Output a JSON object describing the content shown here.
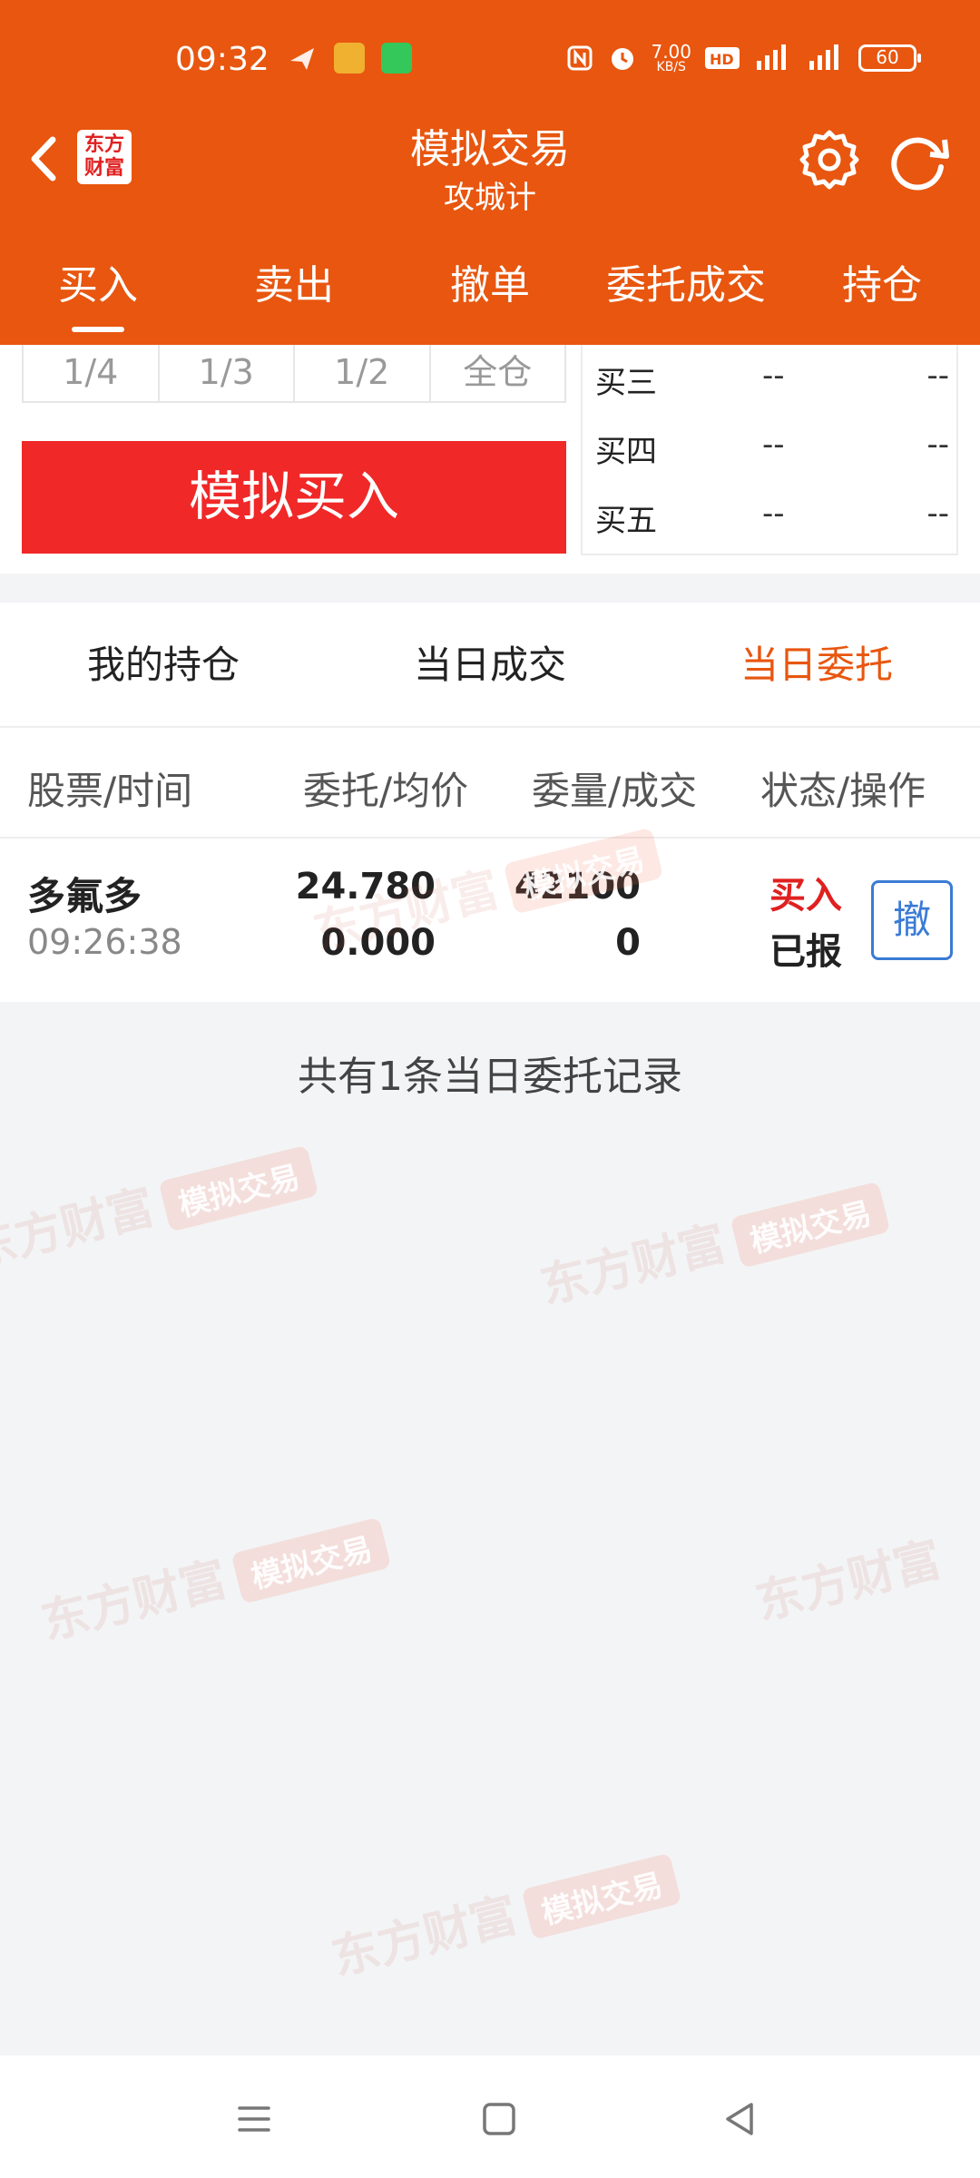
{
  "status_bar": {
    "time": "09:32",
    "net_speed_top": "7.00",
    "net_speed_bottom": "KB/S",
    "battery": "60"
  },
  "header": {
    "logo_text": "东方财富",
    "title": "模拟交易",
    "subtitle": "攻城计",
    "accent_color": "#e8560f"
  },
  "tabs": [
    "买入",
    "卖出",
    "撤单",
    "委托成交",
    "持仓"
  ],
  "order_panel": {
    "fractions": [
      "1/4",
      "1/3",
      "1/2",
      "全仓"
    ],
    "buy_button": "模拟买入",
    "depth": [
      {
        "label": "买三",
        "price": "--",
        "volume": "--"
      },
      {
        "label": "买四",
        "price": "--",
        "volume": "--"
      },
      {
        "label": "买五",
        "price": "--",
        "volume": "--"
      }
    ]
  },
  "subtabs": [
    "我的持仓",
    "当日成交",
    "当日委托"
  ],
  "columns": [
    "股票/时间",
    "委托/均价",
    "委量/成交",
    "状态/操作"
  ],
  "orders": [
    {
      "name": "多氟多",
      "time": "09:26:38",
      "price": "24.780",
      "avg_price": "0.000",
      "quantity": "42100",
      "filled": "0",
      "direction": "买入",
      "status": "已报",
      "cancel": "撤"
    }
  ],
  "summary": "共有1条当日委托记录",
  "watermark": {
    "text": "东方财富",
    "tag": "模拟交易"
  }
}
